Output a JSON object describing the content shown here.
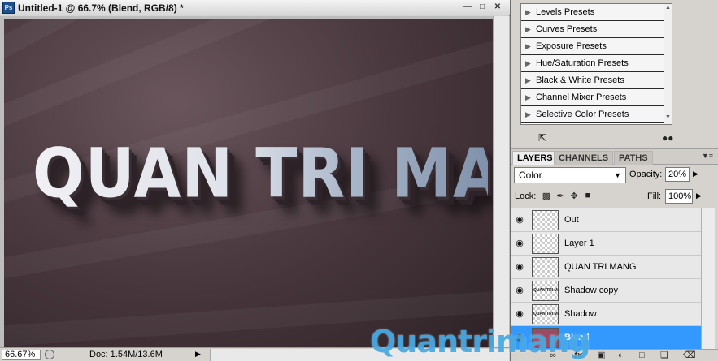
{
  "document": {
    "title": "Untitled-1 @ 66.7% (Blend, RGB/8) *",
    "app_icon": "Ps",
    "canvas_text": "QUAN TRI MANG",
    "zoom": "66.67%",
    "doc_size": "Doc: 1.54M/13.6M"
  },
  "presets": [
    {
      "label": "Levels Presets"
    },
    {
      "label": "Curves Presets"
    },
    {
      "label": "Exposure Presets"
    },
    {
      "label": "Hue/Saturation Presets"
    },
    {
      "label": "Black & White Presets"
    },
    {
      "label": "Channel Mixer Presets"
    },
    {
      "label": "Selective Color Presets"
    }
  ],
  "layers_panel": {
    "tabs": [
      "LAYERS",
      "CHANNELS",
      "PATHS"
    ],
    "active_tab": "LAYERS",
    "blend_mode": "Color",
    "opacity_label": "Opacity:",
    "opacity": "20%",
    "lock_label": "Lock:",
    "fill_label": "Fill:",
    "fill": "100%",
    "layers": [
      {
        "name": "Out",
        "thumb": "transparent",
        "thumb_text": ""
      },
      {
        "name": "Layer 1",
        "thumb": "transparent",
        "thumb_text": ""
      },
      {
        "name": "QUAN TRI MANG",
        "thumb": "transparent",
        "thumb_text": ""
      },
      {
        "name": "Shadow copy",
        "thumb": "transparent",
        "thumb_text": "QUAN TRI MANG"
      },
      {
        "name": "Shadow",
        "thumb": "transparent",
        "thumb_text": "QUAN TRI MANG"
      },
      {
        "name": "Blend",
        "thumb": "solid",
        "thumb_text": "",
        "selected": true
      }
    ]
  },
  "watermark": "Quantrimang",
  "colors": {
    "selection": "#3399ff",
    "blend_fill": "#9b4a63",
    "canvas_bg": "#4c3b41"
  }
}
